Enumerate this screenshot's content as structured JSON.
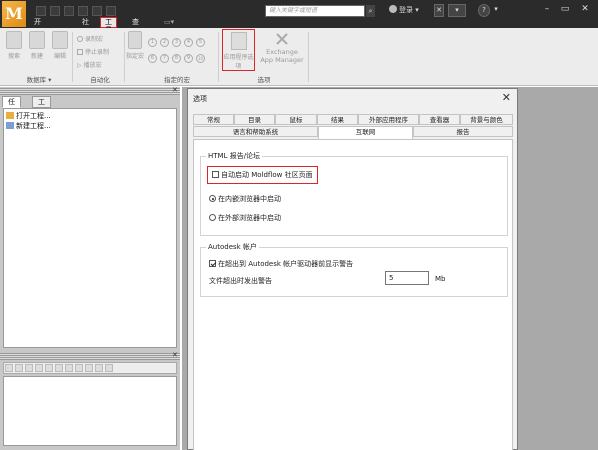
{
  "titlebar": {
    "logo": "M",
    "search_placeholder": "键入关键字或短语",
    "login": "登录",
    "help": "?"
  },
  "menu": {
    "items": [
      "开始并学习",
      "社区",
      "工具",
      "查看"
    ]
  },
  "ribbon": {
    "database_group": {
      "label": "数据库",
      "buttons": [
        "搜索",
        "新建",
        "编辑"
      ]
    },
    "automation_group": {
      "label": "自动化",
      "items": [
        "录制宏",
        "停止录制",
        "播放宏"
      ]
    },
    "macro_group": {
      "label": "指定的宏",
      "assign_label": "指定宏",
      "numbers": [
        "1",
        "2",
        "3",
        "4",
        "5",
        "6",
        "7",
        "8",
        "9",
        "10"
      ]
    },
    "options_group": {
      "label": "选项",
      "app_options_label": "应用程序选项",
      "exchange_label": "Exchange App Manager"
    }
  },
  "left_pane": {
    "tabs": [
      "任务",
      "工具"
    ],
    "tasks": [
      "打开工程...",
      "新建工程..."
    ]
  },
  "dialog": {
    "title": "选项",
    "tabs_row1": [
      "常规",
      "目录",
      "鼠标",
      "结果",
      "外部应用程序",
      "查看器",
      "背景与颜色"
    ],
    "tabs_row2": [
      "语言和帮助系统",
      "互联网",
      "报告"
    ],
    "active_tab": "互联网",
    "html_section": {
      "legend": "HTML 报告/论坛",
      "launch_community": "自动启动 Moldflow 社区页面",
      "launch_community_checked": false,
      "radio_internal": "在内嵌浏览器中启动",
      "radio_internal_selected": true,
      "radio_external": "在外部浏览器中启动",
      "radio_external_selected": false
    },
    "autodesk_section": {
      "legend": "Autodesk 帐户",
      "warn_expire": "在超出到 Autodesk 帐户驱动器前显示警告",
      "warn_expire_checked": true,
      "warn_size_label": "文件超出时发出警告",
      "warn_size_value": "5",
      "warn_size_unit": "Mb"
    }
  }
}
